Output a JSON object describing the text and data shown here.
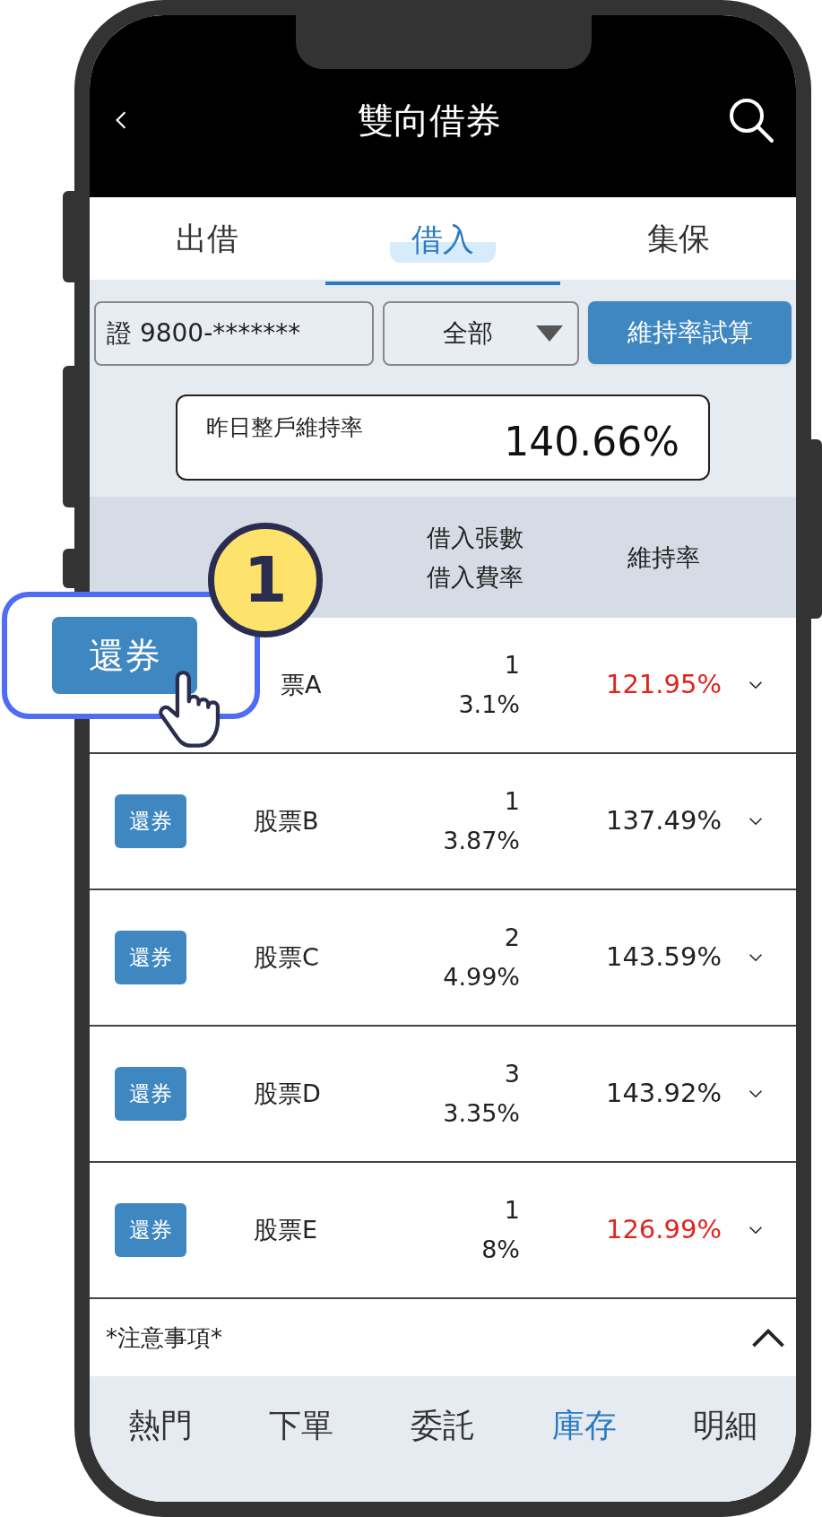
{
  "header": {
    "title": "雙向借券"
  },
  "tabs": [
    {
      "label": "出借",
      "selected": false
    },
    {
      "label": "借入",
      "selected": true
    },
    {
      "label": "集保",
      "selected": false
    }
  ],
  "filters": {
    "account": "證 9800-*******",
    "category": "全部",
    "calc_button": "維持率試算"
  },
  "summary": {
    "label": "昨日整戶維持率",
    "value": "140.66%"
  },
  "table": {
    "columns": [
      {
        "lines": [
          "借入張數",
          "借入費率"
        ]
      },
      {
        "lines": [
          "維持率"
        ]
      }
    ],
    "rows": [
      {
        "name": "票A",
        "quantity": "1",
        "fee_rate": "3.1%",
        "maintenance_rate": "121.95%",
        "alert": true
      },
      {
        "button": "還券",
        "name": "股票B",
        "quantity": "1",
        "fee_rate": "3.87%",
        "maintenance_rate": "137.49%",
        "alert": false
      },
      {
        "button": "還券",
        "name": "股票C",
        "quantity": "2",
        "fee_rate": "4.99%",
        "maintenance_rate": "143.59%",
        "alert": false
      },
      {
        "button": "還券",
        "name": "股票D",
        "quantity": "3",
        "fee_rate": "3.35%",
        "maintenance_rate": "143.92%",
        "alert": false
      },
      {
        "button": "還券",
        "name": "股票E",
        "quantity": "1",
        "fee_rate": "8%",
        "maintenance_rate": "126.99%",
        "alert": true
      }
    ]
  },
  "notes": {
    "title": "*注意事項*"
  },
  "bottom_nav": [
    {
      "label": "熱門",
      "selected": false
    },
    {
      "label": "下單",
      "selected": false
    },
    {
      "label": "委託",
      "selected": false
    },
    {
      "label": "庫存",
      "selected": true
    },
    {
      "label": "明細",
      "selected": false
    }
  ],
  "callout": {
    "number": "1",
    "button": "還券"
  }
}
